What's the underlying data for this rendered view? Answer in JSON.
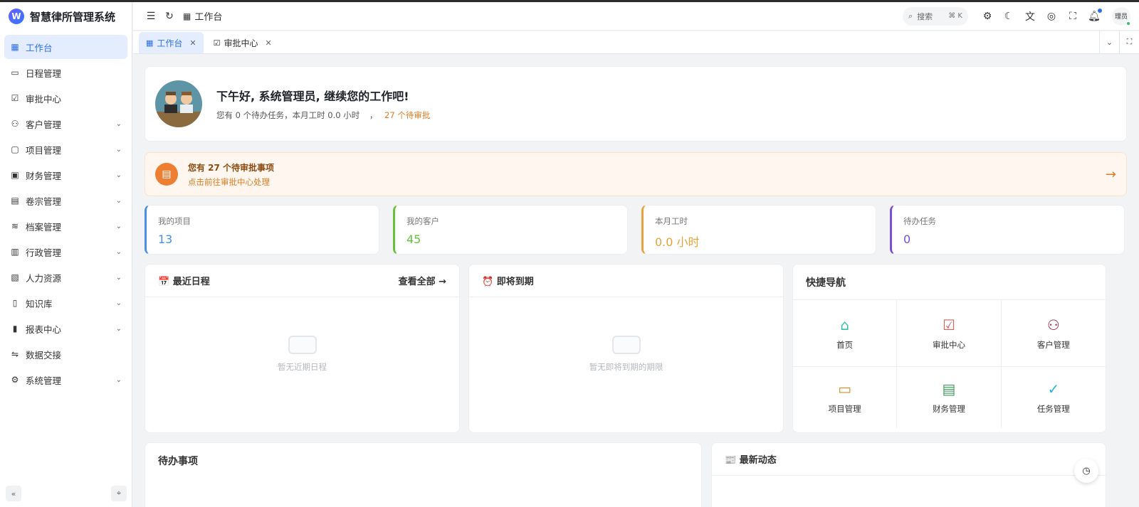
{
  "app": {
    "title": "智慧律所管理系统",
    "logo_letter": "W"
  },
  "sidebar": {
    "items": [
      {
        "label": "工作台",
        "icon": "dashboard-icon",
        "glyph": "▦",
        "active": true,
        "expand": false
      },
      {
        "label": "日程管理",
        "icon": "calendar-icon",
        "glyph": "▭",
        "expand": false
      },
      {
        "label": "审批中心",
        "icon": "approval-icon",
        "glyph": "☑",
        "expand": false
      },
      {
        "label": "客户管理",
        "icon": "users-icon",
        "glyph": "⚇",
        "expand": true
      },
      {
        "label": "项目管理",
        "icon": "folder-icon",
        "glyph": "▢",
        "expand": true
      },
      {
        "label": "财务管理",
        "icon": "wallet-icon",
        "glyph": "▣",
        "expand": true
      },
      {
        "label": "卷宗管理",
        "icon": "file-icon",
        "glyph": "▤",
        "expand": true
      },
      {
        "label": "档案管理",
        "icon": "database-icon",
        "glyph": "≋",
        "expand": true
      },
      {
        "label": "行政管理",
        "icon": "building-icon",
        "glyph": "▥",
        "expand": true
      },
      {
        "label": "人力资源",
        "icon": "id-card-icon",
        "glyph": "▧",
        "expand": true
      },
      {
        "label": "知识库",
        "icon": "book-icon",
        "glyph": "▯",
        "expand": true
      },
      {
        "label": "报表中心",
        "icon": "chart-icon",
        "glyph": "▮",
        "expand": true
      },
      {
        "label": "数据交接",
        "icon": "transfer-icon",
        "glyph": "⇋",
        "expand": false
      },
      {
        "label": "系统管理",
        "icon": "gear-icon",
        "glyph": "⚙",
        "expand": true
      }
    ]
  },
  "header": {
    "breadcrumb": "工作台",
    "search": {
      "placeholder": "搜索",
      "shortcut": "⌘ K"
    },
    "user": "理员"
  },
  "tabs": [
    {
      "label": "工作台",
      "active": true
    },
    {
      "label": "审批中心",
      "active": false
    }
  ],
  "welcome": {
    "title": "下午好, 系统管理员, 继续您的工作吧!",
    "subtitle": "您有 0 个待办任务，本月工时 0.0 小时",
    "sep": "，",
    "pending": "27 个待审批"
  },
  "notice": {
    "title": "您有 27 个待审批事项",
    "link": "点击前往审批中心处理",
    "icon": "clipboard-icon",
    "accent": "#ee7e31"
  },
  "stats": [
    {
      "label": "我的项目",
      "value": "13",
      "color": "#4a90e2"
    },
    {
      "label": "我的客户",
      "value": "45",
      "color": "#67c23a"
    },
    {
      "label": "本月工时",
      "value": "0.0 小时",
      "color": "#e6a23c"
    },
    {
      "label": "待办任务",
      "value": "0",
      "color": "#7b4fd1"
    }
  ],
  "schedule": {
    "title": "📅 最近日程",
    "more": "查看全部 →",
    "empty": "暂无近期日程"
  },
  "due": {
    "title": "⏰ 即将到期",
    "empty": "暂无即将到期的期限"
  },
  "quick": {
    "title": "快捷导航",
    "items": [
      {
        "label": "首页",
        "icon": "home-icon",
        "glyph": "⌂",
        "color": "#3bbfad"
      },
      {
        "label": "审批中心",
        "icon": "check-square-icon",
        "glyph": "☑",
        "color": "#e05a5a"
      },
      {
        "label": "客户管理",
        "icon": "users-icon",
        "glyph": "⚇",
        "color": "#a0304a"
      },
      {
        "label": "项目管理",
        "icon": "briefcase-icon",
        "glyph": "▭",
        "color": "#d98b1f"
      },
      {
        "label": "财务管理",
        "icon": "document-icon",
        "glyph": "▤",
        "color": "#3f9a5c"
      },
      {
        "label": "任务管理",
        "icon": "check-circle-icon",
        "glyph": "✓",
        "color": "#2ab4d6"
      }
    ]
  },
  "todo": {
    "title": "待办事项"
  },
  "news": {
    "title": "📰 最新动态"
  }
}
